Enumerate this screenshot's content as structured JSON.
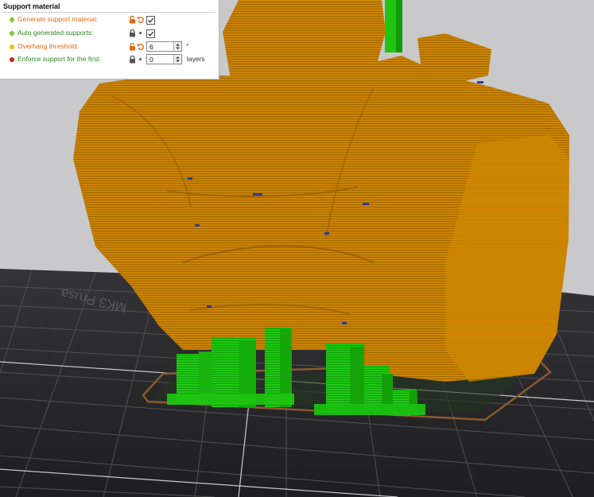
{
  "colors": {
    "background": "#c9c9cc",
    "bed": "#2c2c2e",
    "model": "#c78200",
    "support": "#19c40e",
    "simple": "#7cc73a",
    "advanced": "#f4c400",
    "expert": "#d01f1f",
    "modified_label": "#e56a12",
    "default_label": "#2c8a1e"
  },
  "panel": {
    "title": "Support material",
    "options": [
      {
        "label": "Generate support material:",
        "level": "simple",
        "modified": true,
        "control": "checkbox",
        "checked": true
      },
      {
        "label": "Auto generated supports:",
        "level": "simple",
        "modified": false,
        "control": "checkbox",
        "checked": true
      },
      {
        "label": "Overhang threshold:",
        "level": "advanced",
        "modified": true,
        "control": "spin",
        "value": "6",
        "unit": "°"
      },
      {
        "label": "Enforce support for the first:",
        "level": "expert",
        "modified": false,
        "control": "spin",
        "value": "0",
        "unit": "layers"
      }
    ]
  },
  "viewport": {
    "bed_label": "MK3 Prusa"
  }
}
